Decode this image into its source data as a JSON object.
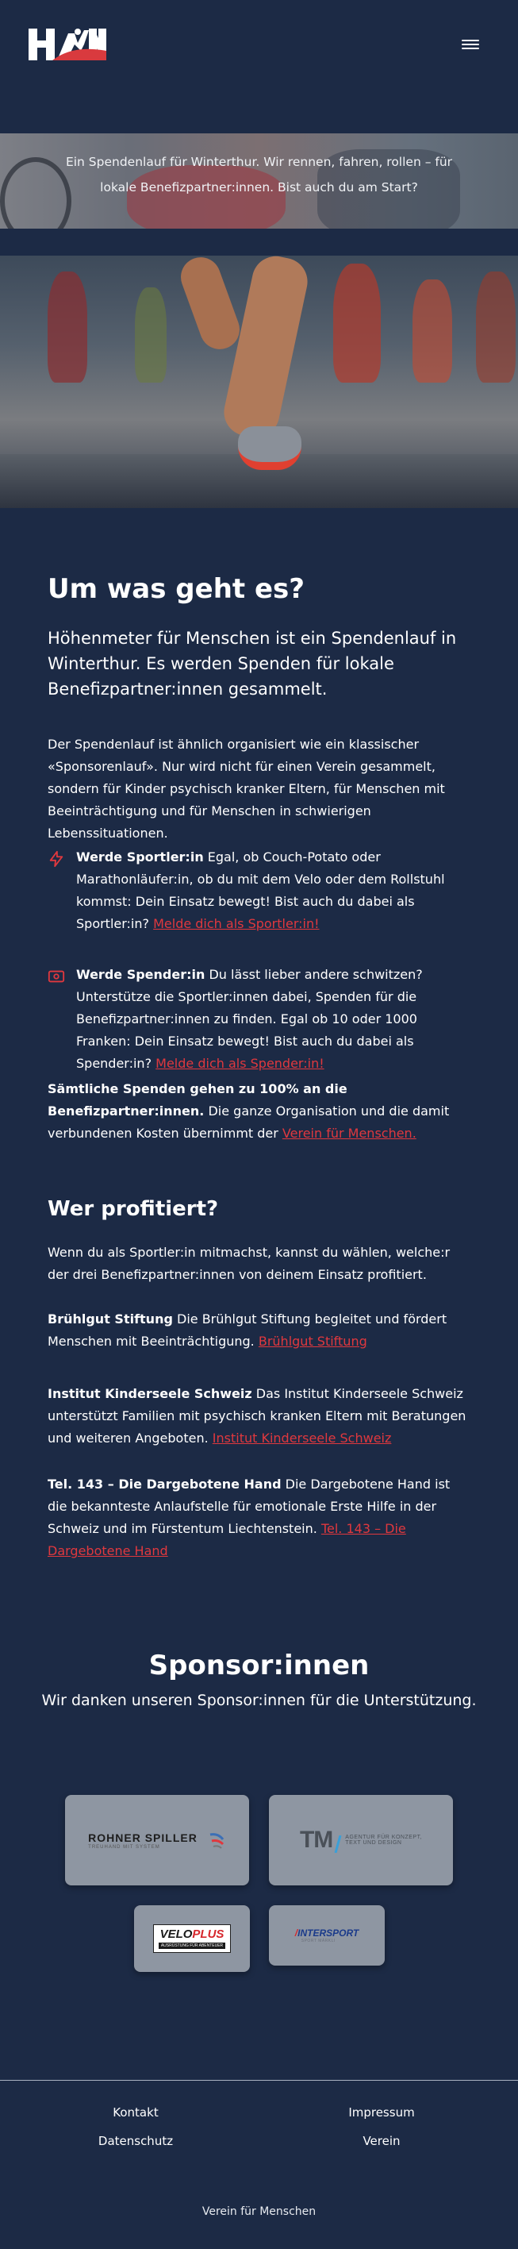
{
  "header": {
    "logo_letters": "HfM",
    "menu_icon": "hamburger-icon"
  },
  "hero": {
    "text": "Ein Spendenlauf für Winterthur. Wir rennen, fahren, rollen – für lokale Benefizpartner:innen. Bist auch du am Start?"
  },
  "about": {
    "title": "Um was geht es?",
    "lead": "Höhenmeter für Menschen ist ein Spendenlauf in Winterthur. Es werden Spenden für lokale Benefizpartner:innen gesammelt.",
    "intro": "Der Spendenlauf ist ähnlich organisiert wie ein klassischer «Sponsorenlauf». Nur wird nicht für einen Verein gesammelt, sondern für Kinder psychisch kranker Eltern, für Menschen mit Beeinträchtigung und für Menschen in schwierigen Lebenssituationen.",
    "sportler": {
      "icon": "lightning-icon",
      "bold": "Werde Sportler:in",
      "text": " Egal, ob Couch-Potato oder Marathonläufer:in, ob du mit dem Velo oder dem Rollstuhl kommst: Dein Einsatz bewegt! Bist auch du dabei als Sportler:in? ",
      "link": "Melde dich als Sportler:in!"
    },
    "spender": {
      "icon": "money-icon",
      "bold": "Werde Spender:in",
      "text": " Du lässt lieber andere schwitzen? Unterstütze die Sportler:innen dabei, Spenden für die Benefizpartner:innen zu finden. Egal ob 10 oder 1000 Franken: Dein Einsatz bewegt! Bist auch du dabei als Spender:in? ",
      "link": "Melde dich als Spender:in!"
    },
    "donation": {
      "bold": "Sämtliche Spenden gehen zu 100% an die Benefizpartner:innen.",
      "text": " Die ganze Organisation und die damit verbundenen Kosten übernimmt der ",
      "link": "Verein für Menschen."
    }
  },
  "beneficiaries": {
    "title": "Wer profitiert?",
    "intro": "Wenn du als Sportler:in mitmachst, kannst du wählen, welche:r der drei Benefizpartner:innen von deinem Einsatz profitiert.",
    "items": [
      {
        "bold": "Brühlgut Stiftung",
        "text": " Die Brühlgut Stiftung begleitet und fördert Menschen mit Beeinträchtigung. ",
        "link": "Brühlgut Stiftung"
      },
      {
        "bold": "Institut Kinderseele Schweiz",
        "text": " Das Institut Kinderseele Schweiz unterstützt Familien mit psychisch kranken Eltern mit Beratungen und weiteren Angeboten. ",
        "link": "Institut Kinderseele Schweiz"
      },
      {
        "bold": "Tel. 143 – Die Dargebotene Hand",
        "text": " Die Dargebotene Hand ist die bekannteste Anlaufstelle für emotionale Erste Hilfe in der Schweiz und im Fürstentum Liechtenstein. ",
        "link": "Tel. 143 – Die Dargebotene Hand"
      }
    ]
  },
  "sponsors": {
    "title": "Sponsor:innen",
    "subtitle": "Wir danken unseren Sponsor:innen für die Unterstützung.",
    "logos": {
      "rohner": {
        "name": "ROHNER SPILLER",
        "tagline": "TREUHAND MIT SYSTEM"
      },
      "tm": {
        "name": "TM",
        "tagline1": "AGENTUR FÜR KONZEPT,",
        "tagline2": "TEXT UND DESIGN"
      },
      "veloplus": {
        "name1": "VELO",
        "name2": "PLUS",
        "tagline": "AUSRÜSTUNG FÜR ABENTEUER"
      },
      "intersport": {
        "name": "INTERSPORT",
        "tagline": "SPORT MÄRKLI"
      }
    }
  },
  "footer": {
    "kontakt": "Kontakt",
    "impressum": "Impressum",
    "datenschutz": "Datenschutz",
    "verein": "Verein",
    "copyright": "Verein für Menschen"
  },
  "colors": {
    "background": "#1c2a45",
    "accent": "#e0383e",
    "card": "#8e96a2"
  }
}
